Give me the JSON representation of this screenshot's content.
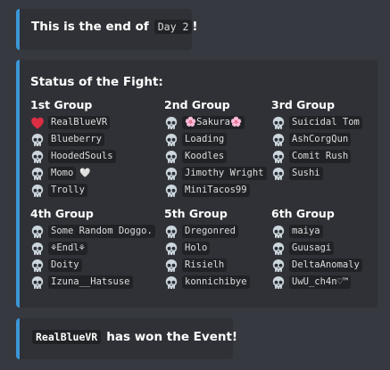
{
  "end_message": {
    "prefix": "This is the end of",
    "day": "Day 2",
    "suffix": "!"
  },
  "fight": {
    "title": "Status of the Fight:",
    "groups": [
      {
        "title": "1st Group",
        "members": [
          {
            "name": "RealBlueVR",
            "status": "alive",
            "icon": "heart-icon"
          },
          {
            "name": "Blueberry",
            "status": "dead",
            "icon": "skull-icon"
          },
          {
            "name": "HoodedSouls",
            "status": "dead",
            "icon": "skull-icon"
          },
          {
            "name": "Momo",
            "extra": "🤍",
            "status": "dead",
            "icon": "skull-icon"
          },
          {
            "name": "Trolly",
            "status": "dead",
            "icon": "skull-icon"
          }
        ]
      },
      {
        "title": "2nd Group",
        "members": [
          {
            "name": "🌸Sakura🌸",
            "status": "dead",
            "icon": "skull-icon"
          },
          {
            "name": "Loading",
            "status": "dead",
            "icon": "skull-icon"
          },
          {
            "name": "Koodles",
            "status": "dead",
            "icon": "skull-icon"
          },
          {
            "name": "Jimothy Wright",
            "status": "dead",
            "icon": "skull-icon"
          },
          {
            "name": "MiniTacos99",
            "status": "dead",
            "icon": "skull-icon"
          }
        ]
      },
      {
        "title": "3rd Group",
        "members": [
          {
            "name": "Suicidal Tom",
            "status": "dead",
            "icon": "skull-icon"
          },
          {
            "name": "AshCorgQun",
            "status": "dead",
            "icon": "skull-icon"
          },
          {
            "name": "Comit Rush",
            "status": "dead",
            "icon": "skull-icon"
          },
          {
            "name": "Sushi",
            "status": "dead",
            "icon": "skull-icon"
          }
        ]
      },
      {
        "title": "4th Group",
        "members": [
          {
            "name": "Some Random Doggo.",
            "status": "dead",
            "icon": "skull-icon"
          },
          {
            "name": "⚘Endl⚘",
            "status": "dead",
            "icon": "skull-icon"
          },
          {
            "name": "Doity",
            "status": "dead",
            "icon": "skull-icon"
          },
          {
            "name": "Izuna__Hatsuse",
            "status": "dead",
            "icon": "skull-icon"
          }
        ]
      },
      {
        "title": "5th Group",
        "members": [
          {
            "name": "Dregonred",
            "status": "dead",
            "icon": "skull-icon"
          },
          {
            "name": "Holo",
            "status": "dead",
            "icon": "skull-icon"
          },
          {
            "name": "Risielh",
            "status": "dead",
            "icon": "skull-icon"
          },
          {
            "name": "konnichibye",
            "status": "dead",
            "icon": "skull-icon"
          }
        ]
      },
      {
        "title": "6th Group",
        "members": [
          {
            "name": "maiya",
            "status": "dead",
            "icon": "skull-icon"
          },
          {
            "name": "Guusagi",
            "status": "dead",
            "icon": "skull-icon"
          },
          {
            "name": "DeltaAnomaly",
            "status": "dead",
            "icon": "skull-icon"
          },
          {
            "name": "UwU_ch4n♡™",
            "status": "dead",
            "icon": "skull-icon"
          }
        ]
      }
    ]
  },
  "winner_message": {
    "winner": "RealBlueVR",
    "suffix": "has won the Event!"
  },
  "colors": {
    "embed_border": "#3b95d6",
    "embed_bg": "#2f3136",
    "background": "#36393f",
    "heart": "#dd2e44"
  }
}
